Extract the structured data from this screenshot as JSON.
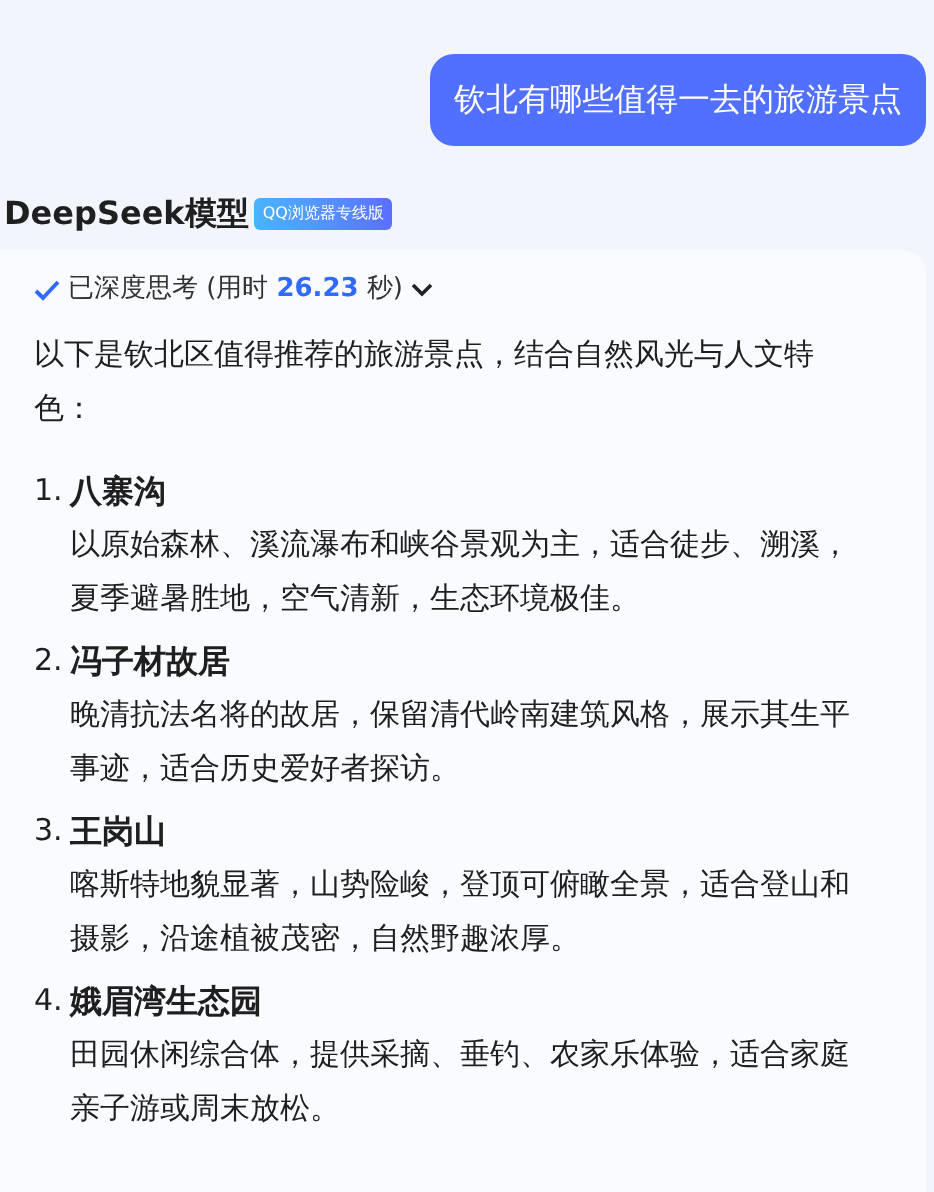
{
  "user_message": "钦北有哪些值得一去的旅游景点",
  "model": {
    "name": "DeepSeek模型",
    "badge": "QQ浏览器专线版"
  },
  "thinking": {
    "status": "已深度思考 (用时",
    "time": "26.23",
    "unit": "秒)"
  },
  "intro": "以下是钦北区值得推荐的旅游景点，结合自然风光与人文特色：",
  "items": [
    {
      "number": "1.",
      "title": "八寨沟",
      "desc": "以原始森林、溪流瀑布和峡谷景观为主，适合徒步、溯溪，夏季避暑胜地，空气清新，生态环境极佳。"
    },
    {
      "number": "2.",
      "title": "冯子材故居",
      "desc": "晚清抗法名将的故居，保留清代岭南建筑风格，展示其生平事迹，适合历史爱好者探访。"
    },
    {
      "number": "3.",
      "title": "王岗山",
      "desc": "喀斯特地貌显著，山势险峻，登顶可俯瞰全景，适合登山和摄影，沿途植被茂密，自然野趣浓厚。"
    },
    {
      "number": "4.",
      "title": "娥眉湾生态园",
      "desc": "田园休闲综合体，提供采摘、垂钓、农家乐体验，适合家庭亲子游或周末放松。"
    }
  ]
}
